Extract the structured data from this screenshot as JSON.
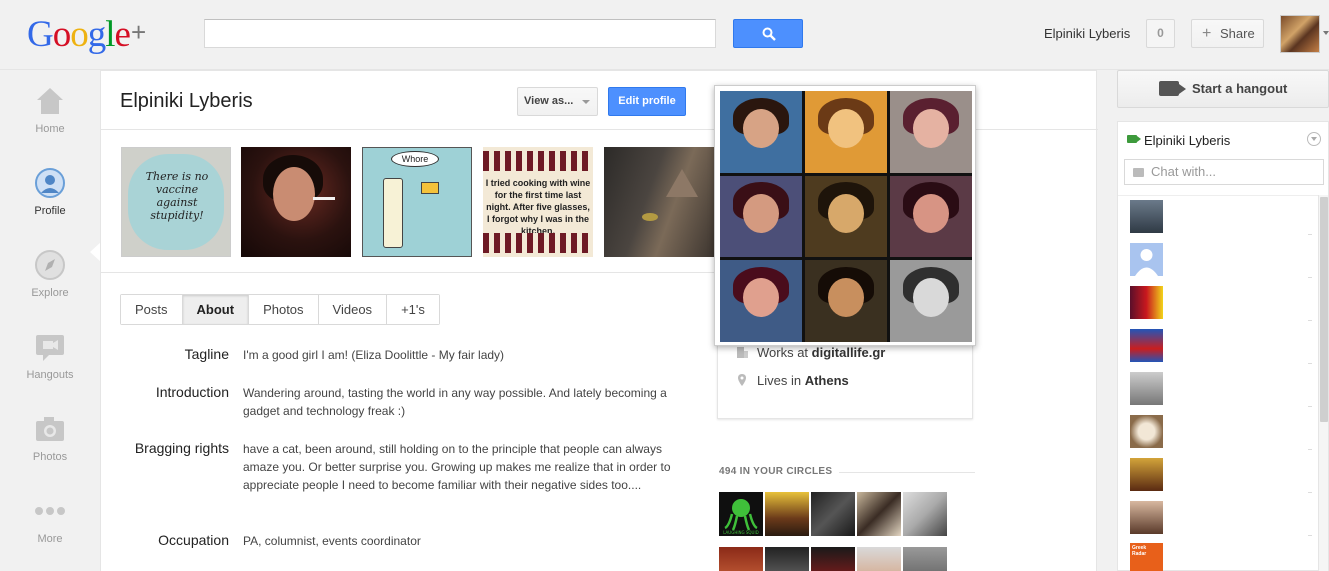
{
  "header": {
    "logo_text": "Google",
    "logo_plus": "+",
    "search_placeholder": "",
    "user_name": "Elpiniki Lyberis",
    "notification_count": "0",
    "share_label": "Share",
    "colors": {
      "search_button": "#4d90fe"
    }
  },
  "nav": {
    "items": [
      {
        "label": "Home",
        "icon": "home-icon"
      },
      {
        "label": "Profile",
        "icon": "profile-icon",
        "active": true
      },
      {
        "label": "Explore",
        "icon": "compass-icon"
      },
      {
        "label": "Hangouts",
        "icon": "hangout-icon"
      },
      {
        "label": "Photos",
        "icon": "camera-icon"
      },
      {
        "label": "More",
        "icon": "more-icon"
      }
    ]
  },
  "profile": {
    "name": "Elpiniki Lyberis",
    "view_as_label": "View as...",
    "edit_profile_label": "Edit profile",
    "photo_texts": {
      "p1": "There is no vaccine against stupidity!",
      "p3": "Whore",
      "p4": "I tried cooking with wine for the first time last night. After five glasses, I forgot why I was in the kitchen."
    },
    "tabs": [
      "Posts",
      "About",
      "Photos",
      "Videos",
      "+1's"
    ],
    "active_tab": "About",
    "about": [
      {
        "label": "Tagline",
        "value": "I'm a good girl I am! (Eliza Doolittle - My fair lady)"
      },
      {
        "label": "Introduction",
        "value": "Wandering around, tasting the world in any way possible. And lately becoming a gadget and technology freak :)"
      },
      {
        "label": "Bragging rights",
        "value": "have a cat, been around, still holding on to the principle that people can always amaze you. Or better surprise you. Growing up makes me realize that in order to appreciate people I need to become familiar with their negative sides too...."
      },
      {
        "label": "Occupation",
        "value": "PA, columnist, events coordinator"
      }
    ],
    "works_prefix": "Works at ",
    "works_at": "digitallife.gr",
    "lives_prefix": "Lives in ",
    "lives_in": "Athens",
    "circles_title": "494 IN YOUR CIRCLES",
    "circle_avatar_text": "LAUGHING SQUID"
  },
  "right_panel": {
    "hangout_label": "Start a hangout",
    "chat_user": "Elpiniki Lyberis",
    "chat_placeholder": "Chat with...",
    "contact_badge": "Greek Radar"
  }
}
